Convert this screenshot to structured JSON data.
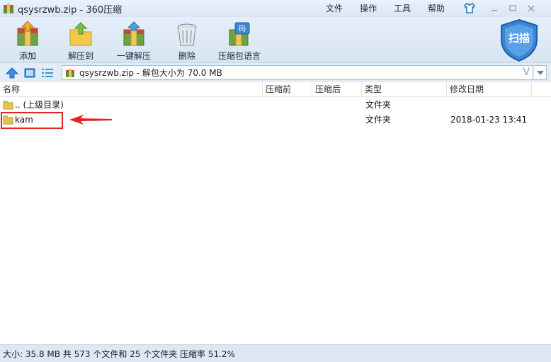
{
  "window": {
    "title": "qsysrzwb.zip - 360压缩"
  },
  "menu": [
    "文件",
    "操作",
    "工具",
    "帮助"
  ],
  "toolbar": {
    "add": "添加",
    "extract_to": "解压到",
    "one_click_extract": "一键解压",
    "delete": "删除",
    "password_language": "压缩包语言",
    "scan": "扫描"
  },
  "address": {
    "path": "qsysrzwb.zip - 解包大小为 70.0 MB",
    "v_glyph": "V"
  },
  "columns": {
    "name": "名称",
    "compressed_before": "压缩前",
    "compressed_after": "压缩后",
    "type": "类型",
    "modified": "修改日期"
  },
  "rows": [
    {
      "name": ".. (上级目录)",
      "type": "文件夹",
      "modified": ""
    },
    {
      "name": "kam",
      "type": "文件夹",
      "modified": "2018-01-23 13:41"
    }
  ],
  "status": {
    "text": "大小: 35.8 MB 共 573 个文件和 25 个文件夹 压缩率 51.2%"
  },
  "colors": {
    "accent_blue": "#2f78c8",
    "highlight_red": "#e32424",
    "folder_yellow": "#e9c24a"
  }
}
